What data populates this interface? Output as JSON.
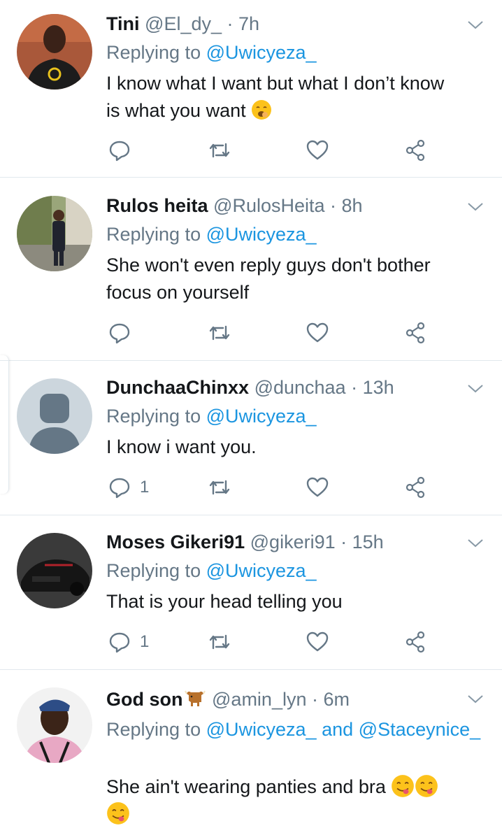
{
  "colors": {
    "link": "#1b95e0",
    "muted": "#657786",
    "text": "#14171a",
    "divider": "#e1e8ed"
  },
  "icons": {
    "reply": "reply-icon",
    "retweet": "retweet-icon",
    "like": "heart-icon",
    "share": "share-icon",
    "more": "chevron-down-icon"
  },
  "tweets": [
    {
      "name": "Tini",
      "handle": "@El_dy_",
      "time": "· 7h",
      "replying_prefix": "Replying to",
      "replying_to": "@Uwicyeza_",
      "text_line1": "I know what I want but what I don’t know",
      "text_line2": "is what you want",
      "reply_count": ""
    },
    {
      "name": "Rulos heita",
      "handle": "@RulosHeita",
      "time": "· 8h",
      "replying_prefix": "Replying to",
      "replying_to": "@Uwicyeza_",
      "text_line1": "She won't even reply guys don't bother",
      "text_line2": "focus on yourself",
      "reply_count": ""
    },
    {
      "name": "DunchaaChinxx",
      "handle": "@dunchaa",
      "time": "· 13h",
      "replying_prefix": "Replying to",
      "replying_to": "@Uwicyeza_",
      "text_line1": "I know i want you.",
      "reply_count": "1"
    },
    {
      "name": "Moses Gikeri91",
      "handle": "@gikeri91",
      "time": "· 15h",
      "replying_prefix": "Replying to",
      "replying_to": "@Uwicyeza_",
      "text_line1": "That is your head telling you",
      "reply_count": "1"
    },
    {
      "name": "God son",
      "handle": "@amin_lyn",
      "time": "· 6m",
      "replying_prefix": "Replying to",
      "replying_to": "@Uwicyeza_",
      "replying_and": "and",
      "replying_to2": "@Staceynice_",
      "text_line1": "She ain't wearing panties and bra"
    }
  ]
}
